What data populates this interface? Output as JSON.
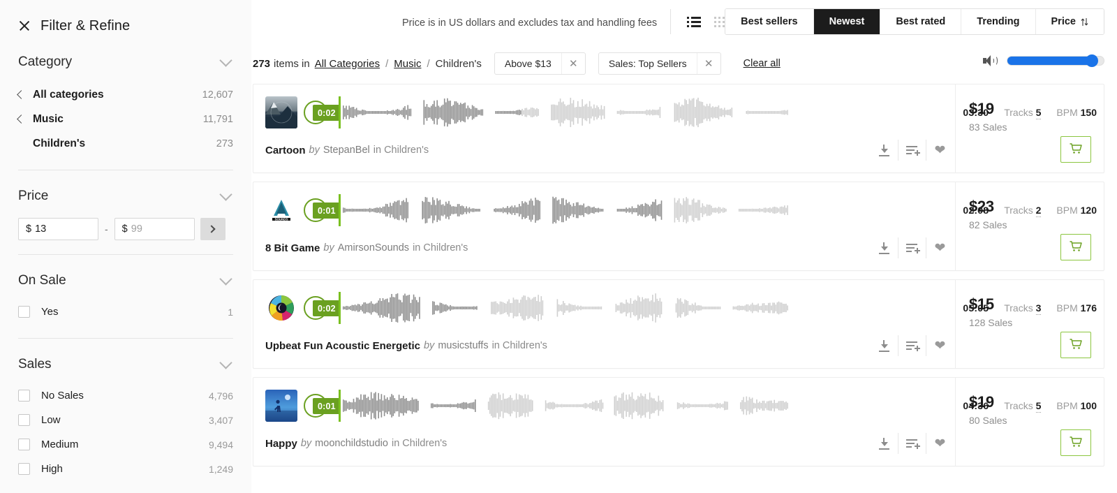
{
  "sidebar": {
    "title": "Filter & Refine",
    "close_icon": "close-icon",
    "facets": {
      "category": {
        "title": "Category",
        "items": [
          {
            "label": "All categories",
            "count": "12,607",
            "has_back": true
          },
          {
            "label": "Music",
            "count": "11,791",
            "has_back": true
          },
          {
            "label": "Children's",
            "count": "273",
            "has_back": false
          }
        ]
      },
      "price": {
        "title": "Price",
        "min_value": "13",
        "min_currency": "$",
        "max_value": "99",
        "max_currency": "$",
        "max_is_placeholder": true,
        "separator": "-",
        "apply_icon": "chevron-right-icon"
      },
      "on_sale": {
        "title": "On Sale",
        "items": [
          {
            "label": "Yes",
            "count": "1",
            "checked": false
          }
        ]
      },
      "sales": {
        "title": "Sales",
        "items": [
          {
            "label": "No Sales",
            "count": "4,796",
            "checked": false
          },
          {
            "label": "Low",
            "count": "3,407",
            "checked": false
          },
          {
            "label": "Medium",
            "count": "9,494",
            "checked": false
          },
          {
            "label": "High",
            "count": "1,249",
            "checked": false
          }
        ]
      }
    }
  },
  "topbar": {
    "price_note": "Price is in US dollars and excludes tax and handling fees",
    "view_list_icon": "list-view-icon",
    "view_grid_icon": "grid-view-icon",
    "active_view": "list",
    "sort_buttons": [
      {
        "label": "Best sellers",
        "active": false
      },
      {
        "label": "Newest",
        "active": true
      },
      {
        "label": "Best rated",
        "active": false
      },
      {
        "label": "Trending",
        "active": false
      },
      {
        "label": "Price",
        "active": false,
        "icon": "sort-arrows-icon"
      }
    ]
  },
  "results": {
    "count": "273",
    "count_suffix": "items in",
    "breadcrumb": [
      {
        "label": "All Categories",
        "link": true
      },
      {
        "label": "Music",
        "link": true
      },
      {
        "label": "Children's",
        "link": false
      }
    ],
    "separator": "/",
    "chips": [
      {
        "label": "Above $13",
        "remove_icon": "close-icon"
      },
      {
        "label": "Sales: Top Sellers",
        "remove_icon": "close-icon"
      }
    ],
    "clear_all": "Clear all"
  },
  "volume": {
    "icon": "speaker-icon",
    "level_percent": 88,
    "fill_color": "#1a73e8"
  },
  "tracks": [
    {
      "title": "Cartoon",
      "by": "by",
      "author": "StepanBel",
      "in": "in Children's",
      "time_badge": "0:02",
      "duration": "03:30",
      "tracks_label": "Tracks",
      "tracks_count": "5",
      "bpm_label": "BPM",
      "bpm": "150",
      "price": "$19",
      "sales": "83 Sales",
      "thumb": "mountain-photo",
      "cart_icon": "cart-icon",
      "download_icon": "download-icon",
      "addlist_icon": "add-to-playlist-icon",
      "favorite_icon": "heart-icon",
      "wave_played_pct": 40
    },
    {
      "title": "8 Bit Game",
      "by": "by",
      "author": "AmirsonSounds",
      "in": "in Children's",
      "time_badge": "0:01",
      "duration": "02:08",
      "tracks_label": "Tracks",
      "tracks_count": "2",
      "bpm_label": "BPM",
      "bpm": "120",
      "price": "$23",
      "sales": "82 Sales",
      "thumb": "a-sounds-logo",
      "cart_icon": "cart-icon",
      "download_icon": "download-icon",
      "addlist_icon": "add-to-playlist-icon",
      "favorite_icon": "heart-icon",
      "wave_played_pct": 74
    },
    {
      "title": "Upbeat Fun Acoustic Energetic",
      "by": "by",
      "author": "musicstuffs",
      "in": "in Children's",
      "time_badge": "0:02",
      "duration": "05:05",
      "tracks_label": "Tracks",
      "tracks_count": "3",
      "bpm_label": "BPM",
      "bpm": "176",
      "price": "$15",
      "sales": "128 Sales",
      "thumb": "shutter-logo",
      "cart_icon": "cart-icon",
      "download_icon": "download-icon",
      "addlist_icon": "add-to-playlist-icon",
      "favorite_icon": "heart-icon",
      "wave_played_pct": 32
    },
    {
      "title": "Happy",
      "by": "by",
      "author": "moonchildstudio",
      "in": "in Children's",
      "time_badge": "0:01",
      "duration": "04:36",
      "tracks_label": "Tracks",
      "tracks_count": "5",
      "bpm_label": "BPM",
      "bpm": "100",
      "price": "$19",
      "sales": "80 Sales",
      "thumb": "moon-child-photo",
      "cart_icon": "cart-icon",
      "download_icon": "download-icon",
      "addlist_icon": "add-to-playlist-icon",
      "favorite_icon": "heart-icon",
      "wave_played_pct": 30
    }
  ]
}
